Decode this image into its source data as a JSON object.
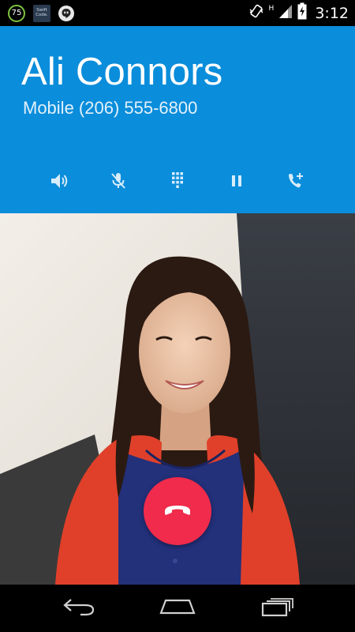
{
  "status_bar": {
    "battery_notification": "75",
    "app_tile_line1": "Swift",
    "app_tile_line2": "Code.",
    "network_type": "H",
    "time": "3:12"
  },
  "caller": {
    "name": "Ali Connors",
    "number_line": "Mobile (206) 555-6800"
  },
  "controls": [
    {
      "icon": "speaker-icon"
    },
    {
      "icon": "mute-mic-icon"
    },
    {
      "icon": "dialpad-icon"
    },
    {
      "icon": "hold-pause-icon"
    },
    {
      "icon": "add-call-icon"
    }
  ],
  "colors": {
    "header": "#0a8ddb",
    "end_call": "#f02b4b",
    "status_bar": "#000000",
    "nav_bar": "#000000"
  },
  "nav": [
    {
      "icon": "back-icon"
    },
    {
      "icon": "home-icon"
    },
    {
      "icon": "recents-icon"
    }
  ]
}
